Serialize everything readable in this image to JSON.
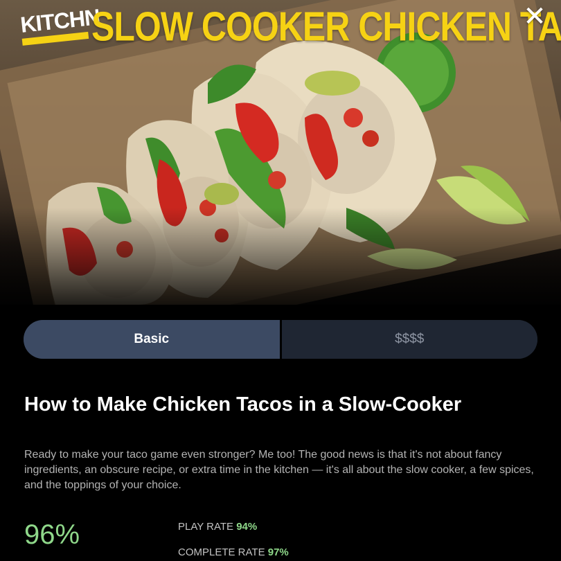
{
  "header": {
    "brand": "KITCHN",
    "headline": "SLOW COOKER CHICKEN TACOS",
    "close_icon": "close-icon"
  },
  "hero": {
    "image": "chicken-tacos-photo"
  },
  "tabs": [
    {
      "label": "Basic",
      "active": true
    },
    {
      "label": "$$$$",
      "active": false
    }
  ],
  "main": {
    "title": "How to Make Chicken Tacos in a Slow-Cooker",
    "description": "Ready to make your taco game even stronger? Me too! The good news is that it's not about fancy ingredients, an obscure recipe, or extra time in the kitchen — it's all about the slow cooker, a few spices, and the toppings of your choice."
  },
  "stats": {
    "score": "96%",
    "play_rate_label": "PLAY RATE",
    "play_rate_value": "94%",
    "complete_rate_label": "COMPLETE RATE",
    "complete_rate_value": "97%"
  },
  "colors": {
    "accent_yellow": "#f6d214",
    "accent_green": "#8fd88a",
    "tab_active": "#3c4a63",
    "tab_inactive": "#1f2633"
  }
}
